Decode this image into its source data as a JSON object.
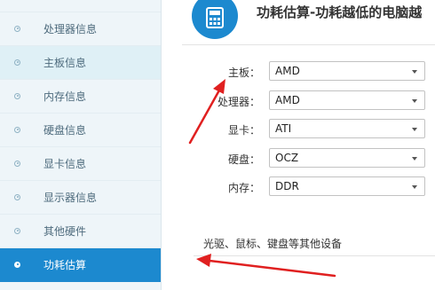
{
  "sidebar": {
    "items": [
      {
        "label": "处理器信息",
        "state": "normal"
      },
      {
        "label": "主板信息",
        "state": "hover"
      },
      {
        "label": "内存信息",
        "state": "normal"
      },
      {
        "label": "硬盘信息",
        "state": "normal"
      },
      {
        "label": "显卡信息",
        "state": "normal"
      },
      {
        "label": "显示器信息",
        "state": "normal"
      },
      {
        "label": "其他硬件",
        "state": "normal"
      },
      {
        "label": "功耗估算",
        "state": "active"
      }
    ]
  },
  "header": {
    "title": "功耗估算-功耗越低的电脑越",
    "icon": "calculator-icon"
  },
  "form": {
    "fields": [
      {
        "label": "主板：",
        "value": "AMD"
      },
      {
        "label": "处理器：",
        "value": "AMD"
      },
      {
        "label": "显卡：",
        "value": "ATI"
      },
      {
        "label": "硬盘：",
        "value": "OCZ"
      },
      {
        "label": "内存：",
        "value": "DDR"
      }
    ],
    "peripherals_label": "光驱、鼠标、键盘等其他设备"
  },
  "colors": {
    "accent": "#1c89cf",
    "sidebar_bg": "#eef5f9",
    "annotation_arrow": "#e02020"
  }
}
